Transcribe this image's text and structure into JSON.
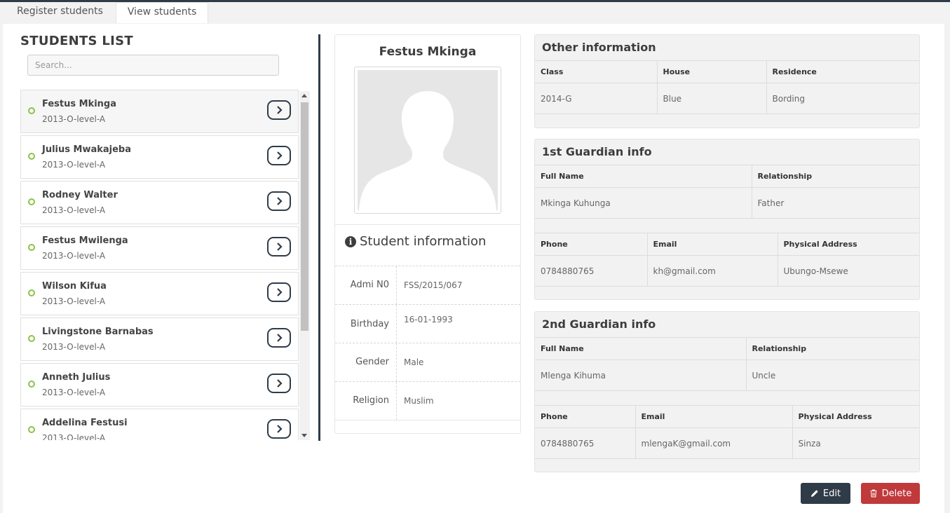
{
  "tabs": [
    {
      "label": "Register students",
      "active": false
    },
    {
      "label": "View students",
      "active": true
    }
  ],
  "list": {
    "title": "STUDENTS LIST",
    "search_placeholder": "Search...",
    "students": [
      {
        "name": "Festus Mkinga",
        "class": "2013-O-level-A"
      },
      {
        "name": "Julius Mwakajeba",
        "class": "2013-O-level-A"
      },
      {
        "name": "Rodney Walter",
        "class": "2013-O-level-A"
      },
      {
        "name": "Festus Mwilenga",
        "class": "2013-O-level-A"
      },
      {
        "name": "Wilson Kifua",
        "class": "2013-O-level-A"
      },
      {
        "name": "Livingstone Barnabas",
        "class": "2013-O-level-A"
      },
      {
        "name": "Anneth Julius",
        "class": "2013-O-level-A"
      },
      {
        "name": "Addelina Festusi",
        "class": "2013-O-level-A"
      }
    ]
  },
  "profile": {
    "name": "Festus Mkinga",
    "info_title": "Student information",
    "fields": [
      {
        "label": "Admi N0",
        "value": "FSS/2015/067"
      },
      {
        "label": "Birthday",
        "value": "16-01-1993"
      },
      {
        "label": "Gender",
        "value": "Male"
      },
      {
        "label": "Religion",
        "value": "Muslim"
      }
    ]
  },
  "other_info": {
    "title": "Other information",
    "headers": [
      "Class",
      "House",
      "Residence"
    ],
    "values": [
      "2014-G",
      "Blue",
      "Bording"
    ]
  },
  "guardian1": {
    "title": "1st Guardian info",
    "headers1": [
      "Full Name",
      "Relationship"
    ],
    "values1": [
      "Mkinga Kuhunga",
      "Father"
    ],
    "headers2": [
      "Phone",
      "Email",
      "Physical Address"
    ],
    "values2": [
      "0784880765",
      "kh@gmail.com",
      "Ubungo-Msewe"
    ]
  },
  "guardian2": {
    "title": "2nd Guardian info",
    "headers1": [
      "Full Name",
      "Relationship"
    ],
    "values1": [
      "Mlenga Kihuma",
      "Uncle"
    ],
    "headers2": [
      "Phone",
      "Email",
      "Physical Address"
    ],
    "values2": [
      "0784880765",
      "mlengaK@gmail.com",
      "Sinza"
    ]
  },
  "actions": {
    "edit": "Edit",
    "delete": "Delete"
  },
  "colors": {
    "dark": "#2f3c48",
    "danger": "#c0393b",
    "online": "#8bc34a"
  }
}
